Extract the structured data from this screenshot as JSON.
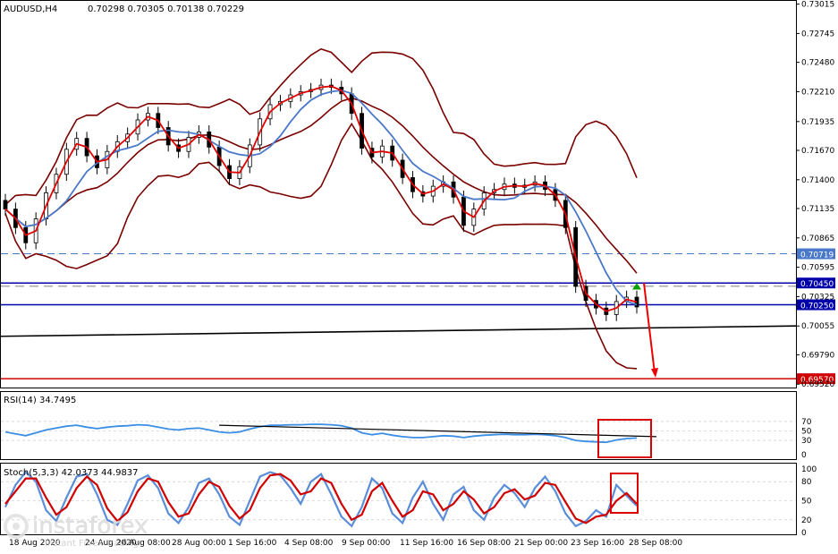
{
  "header": {
    "symbol": "AUDUSD,H4",
    "quote": "0.70298 0.70305 0.70138 0.70229"
  },
  "rsi_panel": {
    "label": "RSI(14) 34.7495"
  },
  "stoch_panel": {
    "label": "Stoch(5,3,3) 42.0373 44.9837"
  },
  "watermark": {
    "brand": "instaforex",
    "tagline": "Instant Forex Trading"
  },
  "colors": {
    "price_bar": "#000000",
    "bollinger": "#7a0000",
    "ma_fast": "#e00000",
    "ma_slow": "#4a78c8",
    "level_line": "#0000aa",
    "support_line": "#d00000",
    "rsi_line": "#3a8ee6",
    "stoch_main": "#5b8ed8",
    "stoch_signal": "#d00000",
    "highlight_box": "#dd0000",
    "arrow_up": "#00a000",
    "arrow_down": "#ee0000"
  },
  "chart_data": [
    {
      "type": "line",
      "title": "AUDUSD,H4",
      "price_axis_ticks": [
        "0.73015",
        "0.72745",
        "0.72480",
        "0.72210",
        "0.71935",
        "0.71670",
        "0.71400",
        "0.71135",
        "0.70865",
        "0.70595",
        "0.70325",
        "0.70055",
        "0.69790",
        "0.69520"
      ],
      "highlighted_levels": [
        {
          "label": "0.70719",
          "value": 0.70719,
          "style": "dashed",
          "color": "#4a78c8"
        },
        {
          "label": "0.70450",
          "value": 0.7045,
          "style": "solid",
          "color": "#0000aa"
        },
        {
          "label": "0.70250",
          "value": 0.7025,
          "style": "solid",
          "color": "#0000aa"
        },
        {
          "label": "0.69570",
          "value": 0.6957,
          "style": "solid",
          "color": "#d00000"
        }
      ],
      "x_tick_labels": [
        "18 Aug 2020",
        "24 Aug 2020",
        "26 Aug 08:00",
        "28 Aug 00:00",
        "1 Sep 16:00",
        "4 Sep 08:00",
        "9 Sep 00:00",
        "11 Sep 16:00",
        "16 Sep 08:00",
        "21 Sep 00:00",
        "23 Sep 16:00",
        "28 Sep 08:00"
      ],
      "series": [
        {
          "name": "close",
          "values": [
            0.7113,
            0.7096,
            0.7082,
            0.7104,
            0.7128,
            0.7145,
            0.7168,
            0.7178,
            0.7162,
            0.7151,
            0.7166,
            0.7175,
            0.7182,
            0.7195,
            0.7201,
            0.7188,
            0.7172,
            0.7166,
            0.7179,
            0.7184,
            0.717,
            0.7153,
            0.7141,
            0.7152,
            0.7172,
            0.7196,
            0.7209,
            0.7212,
            0.7218,
            0.7221,
            0.7223,
            0.7227,
            0.7225,
            0.7219,
            0.7201,
            0.7169,
            0.7161,
            0.7171,
            0.7158,
            0.7142,
            0.7129,
            0.7125,
            0.7134,
            0.7138,
            0.7124,
            0.7098,
            0.7113,
            0.7128,
            0.7131,
            0.7136,
            0.7133,
            0.7135,
            0.7138,
            0.7131,
            0.7121,
            0.7096,
            0.7042,
            0.7029,
            0.7022,
            0.7016,
            0.7028,
            0.7032,
            0.7023
          ]
        }
      ],
      "ylim": [
        0.6953,
        0.7302
      ]
    },
    {
      "type": "line",
      "title": "RSI(14) 34.7495",
      "y_ticks": [
        "70",
        "50",
        "30",
        "0"
      ],
      "ylim": [
        0,
        100
      ],
      "series": [
        {
          "name": "RSI(14)",
          "values": [
            48,
            44,
            40,
            46,
            52,
            56,
            60,
            62,
            58,
            55,
            58,
            60,
            61,
            63,
            62,
            58,
            54,
            52,
            55,
            56,
            52,
            48,
            46,
            48,
            54,
            59,
            62,
            62,
            63,
            63,
            64,
            64,
            63,
            61,
            56,
            46,
            42,
            45,
            41,
            38,
            36,
            36,
            38,
            40,
            39,
            36,
            39,
            41,
            42,
            43,
            42,
            42,
            43,
            42,
            40,
            36,
            30,
            28,
            27,
            26,
            31,
            34,
            35
          ]
        }
      ]
    },
    {
      "type": "line",
      "title": "Stoch(5,3,3) 42.0373 44.9837",
      "y_ticks": [
        "100",
        "80",
        "50",
        "20",
        "0"
      ],
      "ylim": [
        0,
        100
      ],
      "series": [
        {
          "name": "Stoch main",
          "values": [
            40,
            75,
            95,
            80,
            35,
            18,
            55,
            88,
            92,
            60,
            20,
            12,
            45,
            82,
            90,
            70,
            30,
            15,
            40,
            78,
            85,
            60,
            25,
            12,
            50,
            88,
            95,
            90,
            70,
            45,
            80,
            92,
            60,
            25,
            10,
            40,
            85,
            70,
            30,
            15,
            55,
            80,
            45,
            20,
            60,
            72,
            35,
            20,
            55,
            75,
            62,
            40,
            70,
            88,
            65,
            30,
            10,
            18,
            35,
            25,
            75,
            58,
            42
          ]
        },
        {
          "name": "Stoch signal",
          "values": [
            45,
            65,
            85,
            85,
            55,
            28,
            40,
            70,
            88,
            75,
            38,
            18,
            32,
            65,
            85,
            80,
            48,
            25,
            30,
            60,
            80,
            72,
            42,
            22,
            35,
            70,
            90,
            92,
            82,
            60,
            65,
            85,
            78,
            45,
            20,
            28,
            65,
            78,
            50,
            25,
            35,
            65,
            60,
            35,
            45,
            65,
            52,
            30,
            40,
            62,
            68,
            52,
            58,
            78,
            75,
            48,
            22,
            15,
            25,
            28,
            50,
            62,
            45
          ]
        }
      ]
    }
  ]
}
